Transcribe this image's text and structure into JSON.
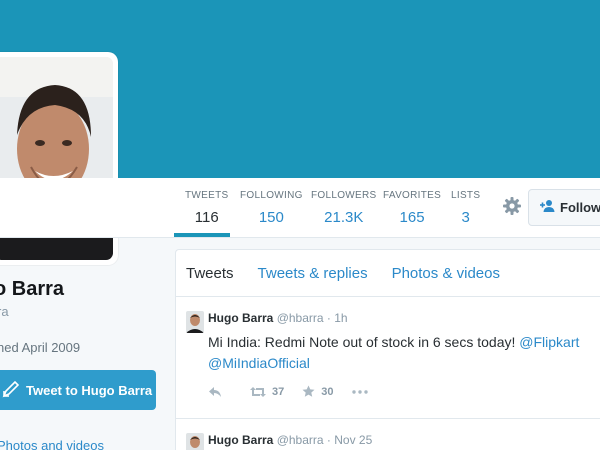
{
  "colors": {
    "banner": "#1b95b8",
    "link": "#2b89c9",
    "button": "#2f9ccc"
  },
  "stats": [
    {
      "label": "TWEETS",
      "value": "116",
      "active": true
    },
    {
      "label": "FOLLOWING",
      "value": "150"
    },
    {
      "label": "FOLLOWERS",
      "value": "21.3K"
    },
    {
      "label": "FAVORITES",
      "value": "165"
    },
    {
      "label": "LISTS",
      "value": "3"
    }
  ],
  "follow_button": {
    "label": "Follow",
    "icon": "add-person-icon"
  },
  "settings_icon": "gear-icon",
  "profile": {
    "name": "o Barra",
    "handle": "ra",
    "joined": "ned April 2009",
    "tweet_to_label": "Tweet to Hugo Barra",
    "photos_link": "Photos and videos"
  },
  "timeline": {
    "tabs": [
      "Tweets",
      "Tweets & replies",
      "Photos & videos"
    ],
    "tweets": [
      {
        "name": "Hugo Barra",
        "handle": "@hbarra",
        "time": "· 1h",
        "text_pre": "Mi India: Redmi Note out of stock in 6 secs today! ",
        "link1": "@Flipkart",
        "link2": "@MiIndiaOfficial",
        "retweets": "37",
        "favorites": "30"
      },
      {
        "name": "Hugo Barra",
        "handle": "@hbarra",
        "time": "· Nov 25"
      }
    ]
  }
}
